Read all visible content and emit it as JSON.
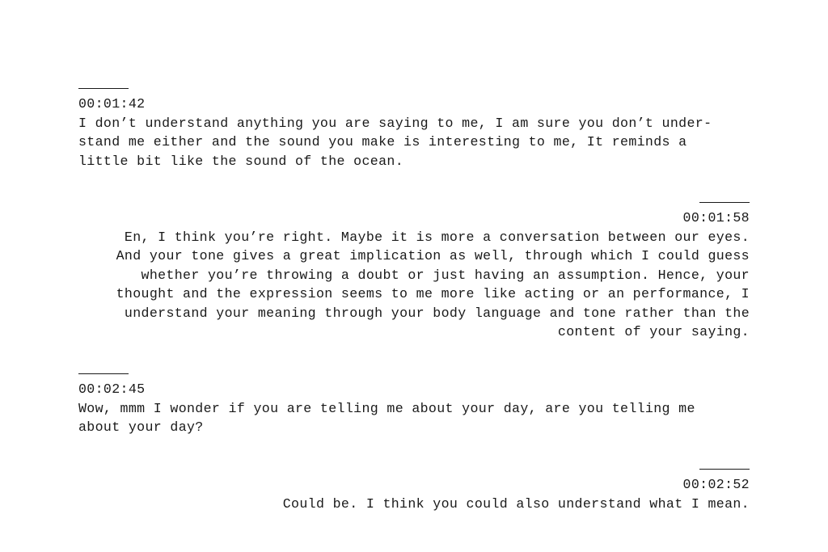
{
  "entries": [
    {
      "timestamp": "00:01:42",
      "text": "I don’t understand anything you are saying to me, I am sure you don’t under-\nstand me either and the sound you make is interesting to me, It reminds a\nlittle bit like the sound of the ocean."
    },
    {
      "timestamp": "00:01:58",
      "text": "En, I think you’re right. Maybe it is more a conversation between our eyes.\nAnd your tone gives a great implication as well, through which I could guess\nwhether you’re throwing a doubt or just having an assumption. Hence, your\nthought and the expression seems to me more like acting or an performance, I\nunderstand your meaning through your body language and tone rather than the\ncontent of your saying."
    },
    {
      "timestamp": "00:02:45",
      "text": "Wow, mmm I wonder if you are telling me about your day, are you telling me\nabout your day?"
    },
    {
      "timestamp": "00:02:52",
      "text": "Could be. I think you could also understand what I mean."
    }
  ]
}
